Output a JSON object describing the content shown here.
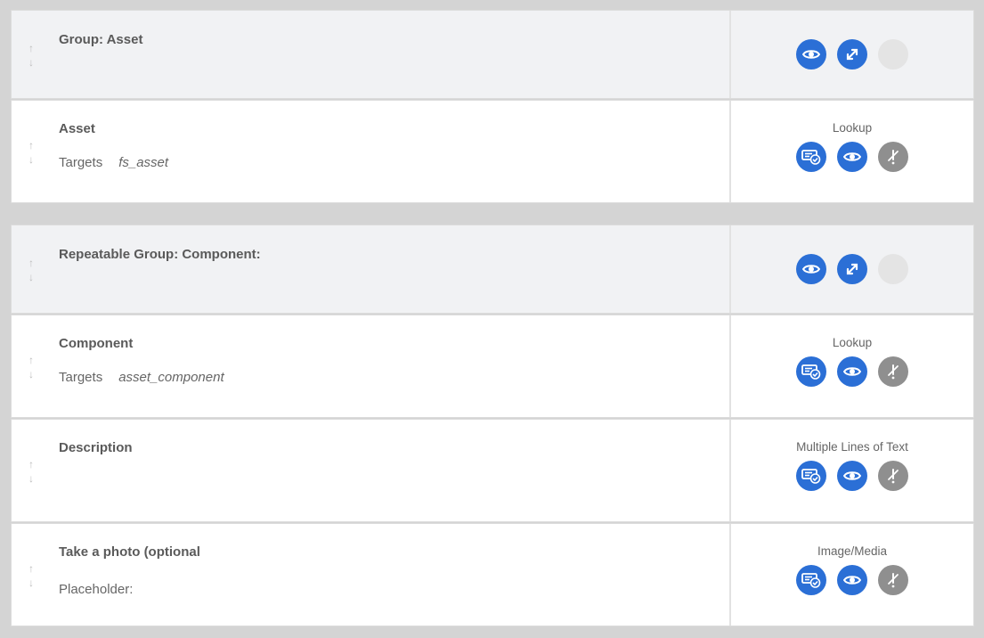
{
  "sections": [
    {
      "rows": [
        {
          "kind": "group",
          "title": "Group: Asset"
        },
        {
          "kind": "field",
          "title": "Asset",
          "sub_label": "Targets",
          "sub_value": "fs_asset",
          "type": "Lookup"
        }
      ]
    },
    {
      "rows": [
        {
          "kind": "group",
          "title": "Repeatable Group: Component:"
        },
        {
          "kind": "field",
          "title": "Component",
          "sub_label": "Targets",
          "sub_value": "asset_component",
          "type": "Lookup"
        },
        {
          "kind": "field",
          "title": "Description",
          "type": "Multiple Lines of Text"
        },
        {
          "kind": "field",
          "title": "Take a photo (optional",
          "sub_label": "Placeholder:",
          "type": "Image/Media"
        }
      ]
    }
  ],
  "icons": {
    "group_actions": [
      "eye-icon",
      "expand-icon",
      "empty-slot"
    ],
    "field_actions": [
      "required-check-icon",
      "eye-icon",
      "disable-icon"
    ]
  },
  "colors": {
    "accent_blue": "#2b6fd6",
    "disabled_gray": "#8f8f8f",
    "group_bg": "#f1f2f4",
    "page_bg": "#d4d4d4"
  }
}
